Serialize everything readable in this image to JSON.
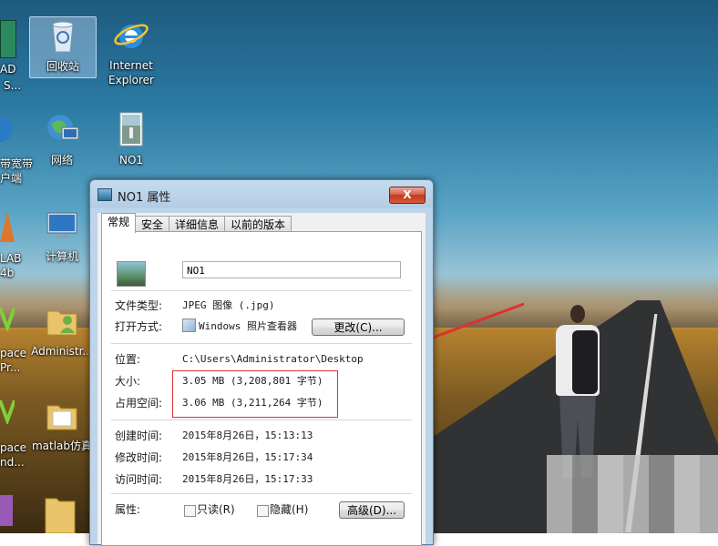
{
  "desktop": {
    "icons": [
      {
        "label": "回收站",
        "icon": "recycle-bin-icon"
      },
      {
        "label": "Internet Explorer",
        "icon": "internet-explorer-icon"
      },
      {
        "label": "网络",
        "icon": "network-icon"
      },
      {
        "label": "NO1",
        "icon": "image-file-icon"
      },
      {
        "label": "计算机",
        "icon": "computer-icon"
      },
      {
        "label": "Administr...",
        "icon": "user-folder-icon"
      },
      {
        "label": "matlab仿真",
        "icon": "folder-icon"
      }
    ],
    "partial_labels": [
      "AD",
      "S...",
      "带宽带",
      "户端",
      "LAB",
      "4b",
      "pace",
      "Pr...",
      "pace",
      "nd..."
    ]
  },
  "dialog": {
    "title": "NO1 属性",
    "close_label": "X",
    "tabs": [
      {
        "label": "常规",
        "active": true
      },
      {
        "label": "安全",
        "active": false
      },
      {
        "label": "详细信息",
        "active": false
      },
      {
        "label": "以前的版本",
        "active": false
      }
    ],
    "file_name": "NO1",
    "fields": {
      "file_type": {
        "label": "文件类型:",
        "value": "JPEG 图像 (.jpg)"
      },
      "open_with": {
        "label": "打开方式:",
        "value": "Windows 照片查看器",
        "button": "更改(C)..."
      },
      "location": {
        "label": "位置:",
        "value": "C:\\Users\\Administrator\\Desktop"
      },
      "size": {
        "label": "大小:",
        "value": "3.05 MB (3,208,801 字节)"
      },
      "size_on_disk": {
        "label": "占用空间:",
        "value": "3.06 MB (3,211,264 字节)"
      },
      "created": {
        "label": "创建时间:",
        "value": "2015年8月26日，15:13:13"
      },
      "modified": {
        "label": "修改时间:",
        "value": "2015年8月26日，15:17:34"
      },
      "accessed": {
        "label": "访问时间:",
        "value": "2015年8月26日，15:17:33"
      }
    },
    "attributes": {
      "label": "属性:",
      "readonly": "只读(R)",
      "hidden": "隐藏(H)",
      "advanced_button": "高级(D)..."
    }
  },
  "annotation_color": "#e03030"
}
